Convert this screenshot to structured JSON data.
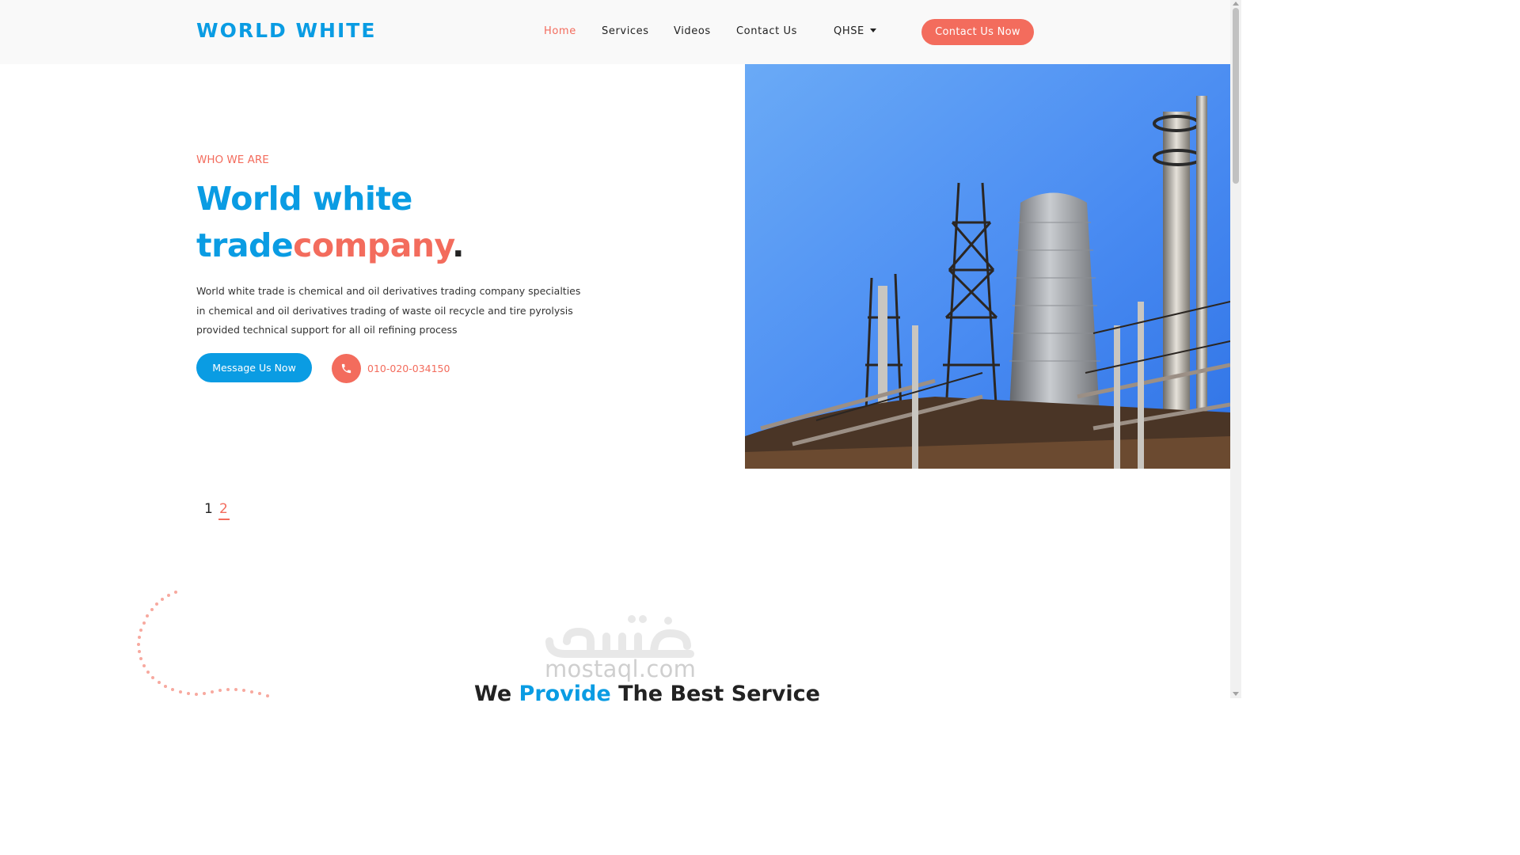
{
  "header": {
    "brand": "WORLD WHITE",
    "nav": {
      "home": "Home",
      "services": "Services",
      "videos": "Videos",
      "contact": "Contact Us",
      "qhse": "QHSE"
    },
    "cta_label": "Contact Us Now"
  },
  "hero": {
    "eyebrow": "WHO WE ARE",
    "title_line1": "World white",
    "title_part_blue": "trade",
    "title_part_coral": "company",
    "title_period": ".",
    "description": "World white trade is chemical and oil derivatives trading company specialties in chemical and oil derivatives trading of waste oil recycle and tire pyrolysis provided technical support for all oil refining process",
    "message_button": "Message Us Now",
    "phone": "010-020-034150"
  },
  "slider": {
    "pages": [
      "1",
      "2"
    ],
    "active_page": "2"
  },
  "services_section": {
    "title_dark_1": "We ",
    "title_blue": "Provide",
    "title_dark_2": " The Best Service"
  },
  "watermark": {
    "logo_text": "مستقل",
    "site": "mostaql.com"
  },
  "colors": {
    "brand_blue": "#0a9ce3",
    "accent_coral": "#f36c5d",
    "text_dark": "#222222",
    "sky": "#4e90f3"
  },
  "icons": [
    "phone-icon",
    "dropdown-caret-icon",
    "decorative-dots-icon"
  ]
}
